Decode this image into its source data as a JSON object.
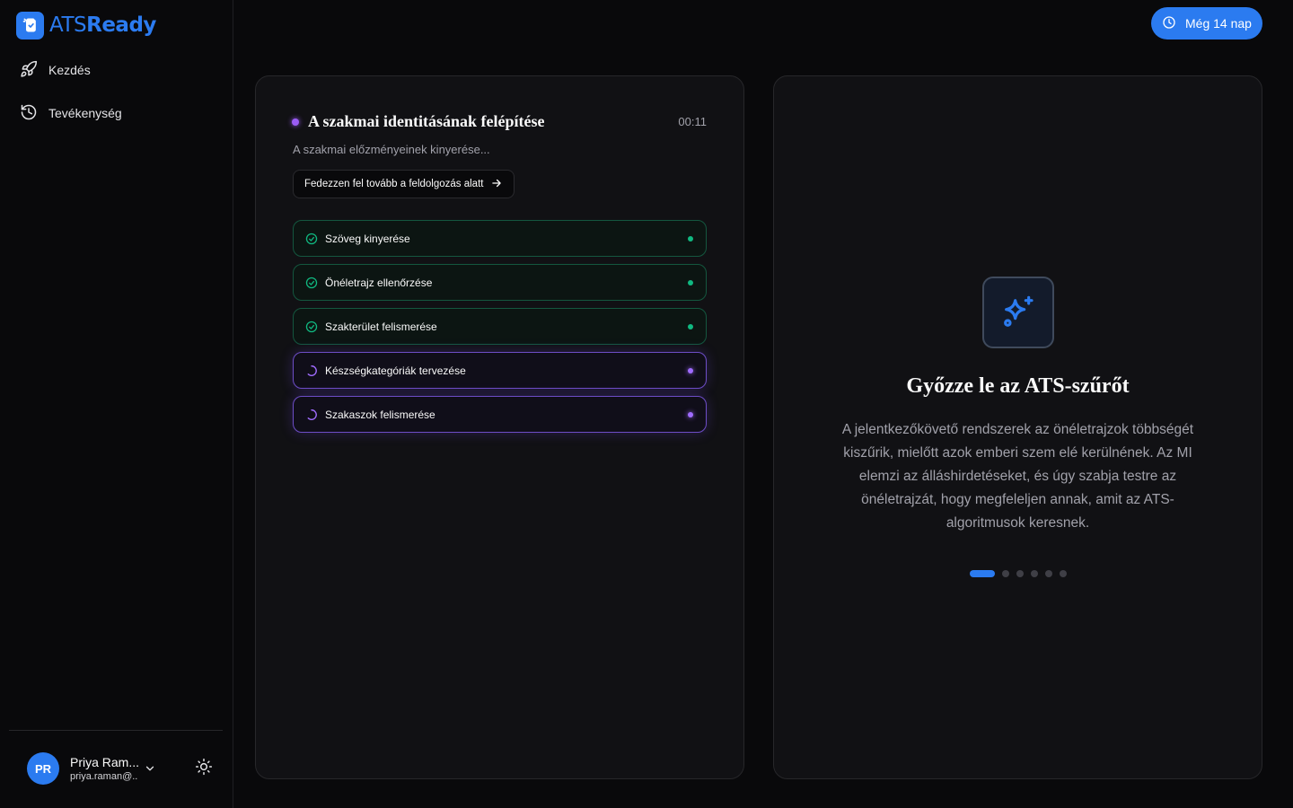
{
  "brand": {
    "name_part1": "ATS",
    "name_part2": "Ready"
  },
  "sidebar": {
    "items": [
      {
        "label": "Kezdés",
        "icon": "rocket-icon"
      },
      {
        "label": "Tevékenység",
        "icon": "history-icon"
      }
    ]
  },
  "user": {
    "initials": "PR",
    "name": "Priya Ram...",
    "email": "priya.raman@..."
  },
  "trial": {
    "label": "Még 14 nap"
  },
  "processing": {
    "title": "A szakmai identitásának felépítése",
    "timer": "00:11",
    "subtitle": "A szakmai előzményeinek kinyerése...",
    "explore_label": "Fedezzen fel tovább a feldolgozás alatt",
    "steps": [
      {
        "label": "Szöveg kinyerése",
        "status": "done"
      },
      {
        "label": "Önéletrajz ellenőrzése",
        "status": "done"
      },
      {
        "label": "Szakterület felismerése",
        "status": "done"
      },
      {
        "label": "Készségkategóriák tervezése",
        "status": "active"
      },
      {
        "label": "Szakaszok felismerése",
        "status": "active"
      }
    ]
  },
  "feature": {
    "icon": "sparkles-icon",
    "title": "Győzze le az ATS-szűrőt",
    "description": "A jelentkezőkövető rendszerek az önéletrajzok többségét kiszűrik, mielőtt azok emberi szem elé kerülnének. Az MI elemzi az álláshirdetéseket, és úgy szabja testre az önéletrajzát, hogy megfeleljen annak, amit az ATS-algoritmusok keresnek.",
    "carousel_active": 1,
    "carousel_total": 6
  },
  "colors": {
    "accent": "#2b7bf0",
    "success": "#10b981",
    "progress": "#9b5cf6",
    "background": "#09090b"
  }
}
